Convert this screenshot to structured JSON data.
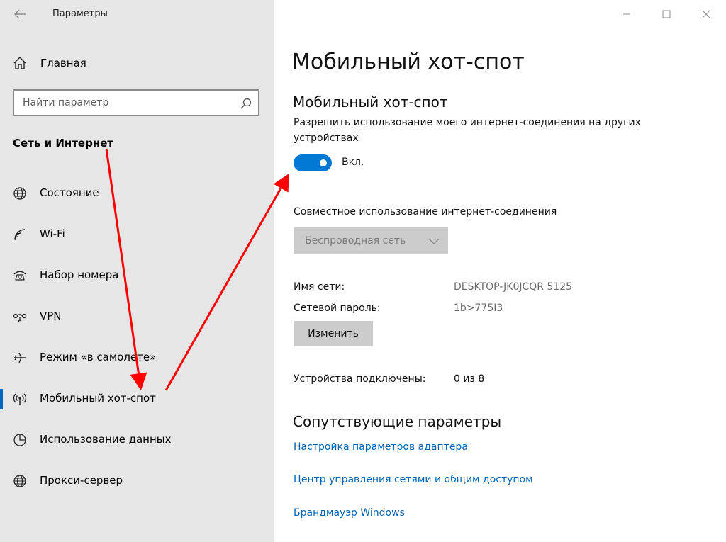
{
  "window": {
    "title": "Параметры"
  },
  "sidebar": {
    "home_label": "Главная",
    "search_placeholder": "Найти параметр",
    "section_title": "Сеть и Интернет",
    "items": [
      {
        "label": "Состояние",
        "icon": "globe-icon"
      },
      {
        "label": "Wi-Fi",
        "icon": "wifi-icon"
      },
      {
        "label": "Набор номера",
        "icon": "dialup-icon"
      },
      {
        "label": "VPN",
        "icon": "vpn-icon"
      },
      {
        "label": "Режим «в самолете»",
        "icon": "airplane-icon"
      },
      {
        "label": "Мобильный хот-спот",
        "icon": "hotspot-icon",
        "selected": true
      },
      {
        "label": "Использование данных",
        "icon": "data-usage-icon"
      },
      {
        "label": "Прокси-сервер",
        "icon": "globe-icon"
      }
    ]
  },
  "main": {
    "page_title": "Мобильный хот-спот",
    "sub_title": "Мобильный хот-спот",
    "description": "Разрешить использование моего интернет-соединения на других устройствах",
    "toggle": {
      "state": "on",
      "label": "Вкл."
    },
    "share_label": "Совместное использование интернет-соединения",
    "share_dropdown_value": "Беспроводная сеть",
    "network_name_label": "Имя сети:",
    "network_name_value": "DESKTOP-JK0JCQR 5125",
    "password_label": "Сетевой пароль:",
    "password_value": "1b>775I3",
    "edit_button": "Изменить",
    "devices_label": "Устройства подключены:",
    "devices_value": "0 из 8",
    "related_title": "Сопутствующие параметры",
    "links": [
      "Настройка параметров адаптера",
      "Центр управления сетями и общим доступом",
      "Брандмауэр Windows"
    ]
  },
  "colors": {
    "accent": "#0078d4",
    "link": "#0063b1",
    "sidebar_bg": "#e6e6e6",
    "annotation_arrow": "#ff0000"
  }
}
